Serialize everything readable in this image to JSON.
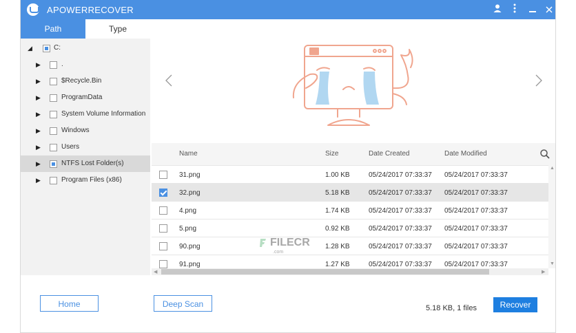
{
  "app": {
    "title": "APOWERRECOVER"
  },
  "tabs": [
    {
      "label": "Path"
    },
    {
      "label": "Type"
    }
  ],
  "tree": {
    "root": {
      "label": "C:"
    },
    "items": [
      {
        "label": "."
      },
      {
        "label": "$Recycle.Bin"
      },
      {
        "label": "ProgramData"
      },
      {
        "label": "System Volume Information"
      },
      {
        "label": "Windows"
      },
      {
        "label": "Users"
      },
      {
        "label": "NTFS Lost Folder(s)"
      },
      {
        "label": "Program Files (x86)"
      }
    ]
  },
  "table": {
    "headers": {
      "name": "Name",
      "size": "Size",
      "created": "Date Created",
      "modified": "Date Modified"
    },
    "rows": [
      {
        "name": "31.png",
        "size": "1.00 KB",
        "created": "05/24/2017 07:33:37",
        "modified": "05/24/2017 07:33:37",
        "checked": false
      },
      {
        "name": "32.png",
        "size": "5.18 KB",
        "created": "05/24/2017 07:33:37",
        "modified": "05/24/2017 07:33:37",
        "checked": true
      },
      {
        "name": "4.png",
        "size": "1.74 KB",
        "created": "05/24/2017 07:33:37",
        "modified": "05/24/2017 07:33:37",
        "checked": false
      },
      {
        "name": "5.png",
        "size": "0.92 KB",
        "created": "05/24/2017 07:33:37",
        "modified": "05/24/2017 07:33:37",
        "checked": false
      },
      {
        "name": "90.png",
        "size": "1.28 KB",
        "created": "05/24/2017 07:33:37",
        "modified": "05/24/2017 07:33:37",
        "checked": false
      },
      {
        "name": "91.png",
        "size": "1.27 KB",
        "created": "05/24/2017 07:33:37",
        "modified": "05/24/2017 07:33:37",
        "checked": false
      }
    ]
  },
  "footer": {
    "home_label": "Home",
    "deep_scan_label": "Deep Scan",
    "status": "5.18 KB, 1 files",
    "recover_label": "Recover"
  },
  "watermark": {
    "text": "FILECR",
    "sub": ".com"
  },
  "colors": {
    "accent": "#4a90e2",
    "recover": "#1e7fe0",
    "illustration": "#f0a58e"
  }
}
